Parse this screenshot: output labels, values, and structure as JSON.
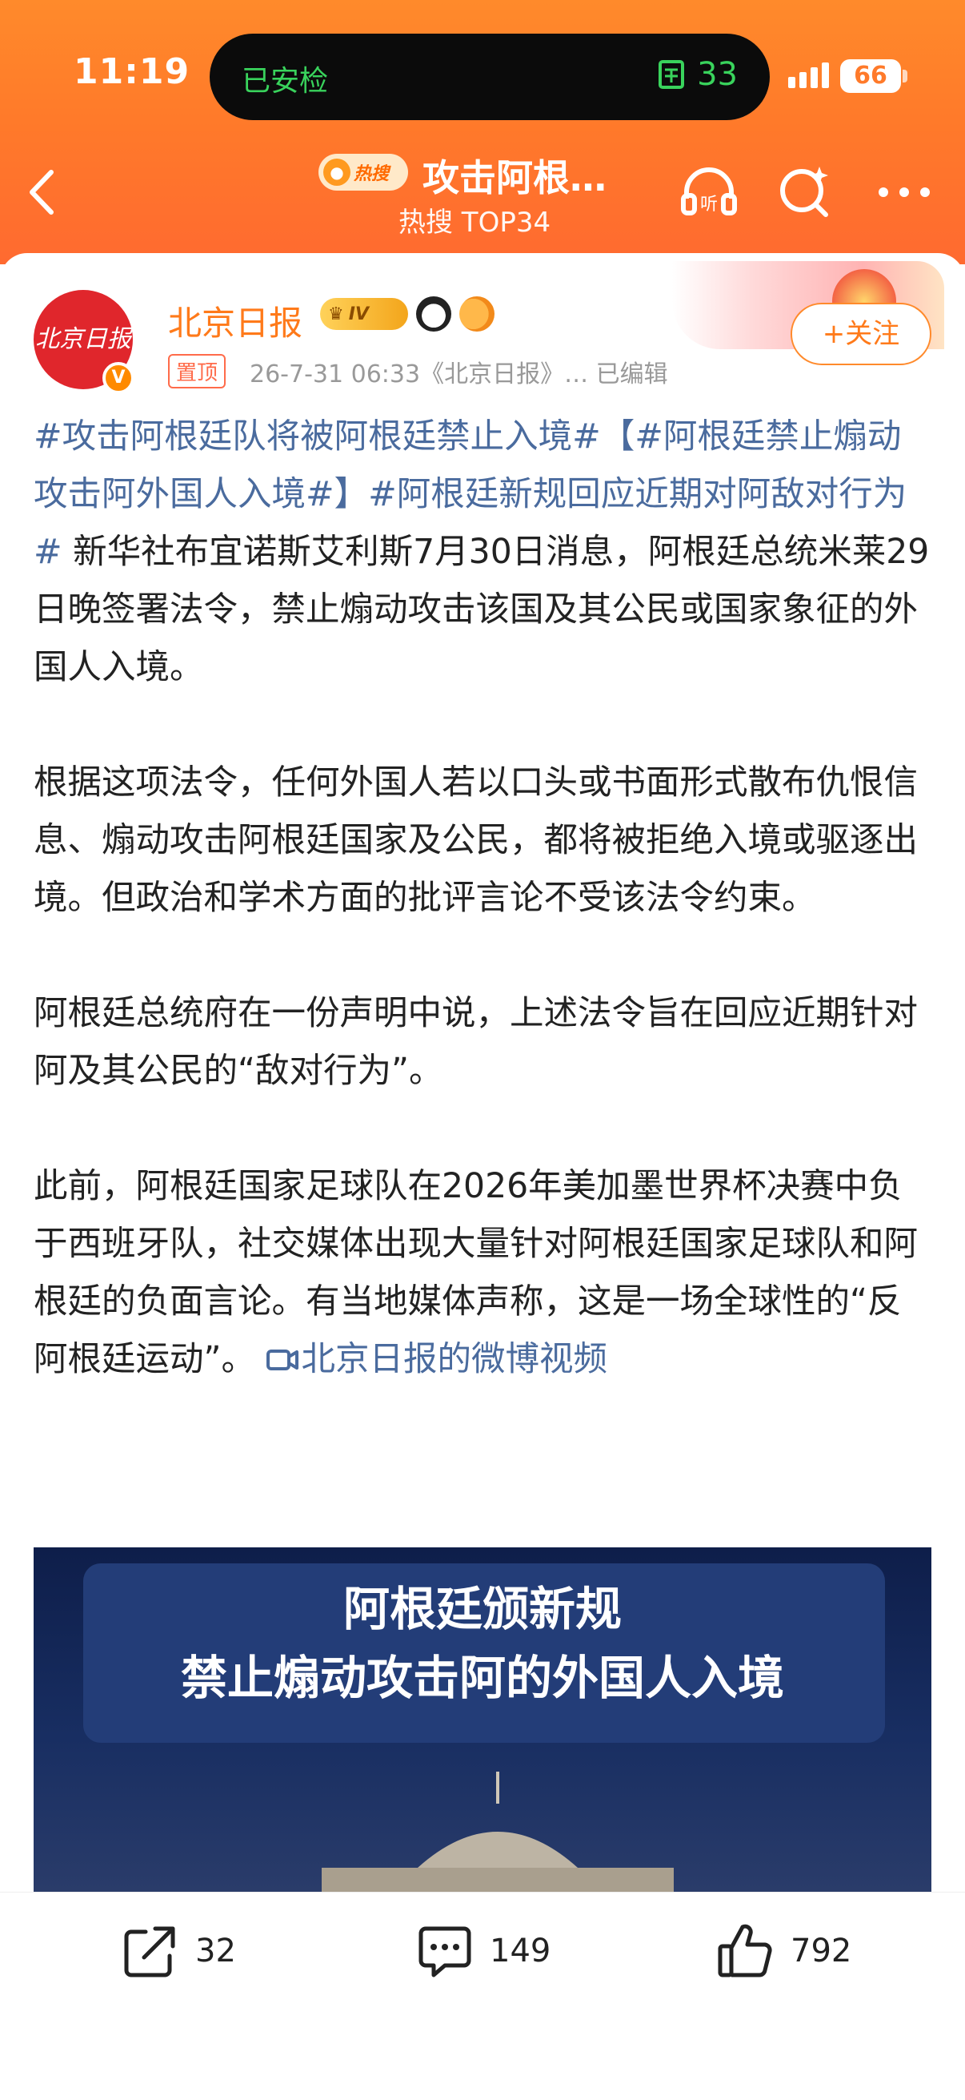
{
  "status_bar": {
    "time": "11:19",
    "island_left": "已安检",
    "island_count": "33",
    "battery": "66"
  },
  "header": {
    "hot_badge": "热搜",
    "title": "攻击阿根…",
    "subtitle": "热搜 TOP34"
  },
  "post": {
    "author": "北京日报",
    "avatar_text": "北京日报",
    "badge_level": "IV",
    "pinned": "置顶",
    "meta": "26-7-31 06:33《北京日报》… 已编辑",
    "follow_label": "+关注",
    "tag1": "#攻击阿根廷队将被阿根廷禁止入境#",
    "tag2": "【#阿根廷禁止煽动攻击阿外国人入境#】",
    "tag3": "#阿根廷新规回应近期对阿敌对行为#",
    "para1": " 新华社布宜诺斯艾利斯7月30日消息，阿根廷总统米莱29日晚签署法令，禁止煽动攻击该国及其公民或国家象征的外国人入境。",
    "para2": "根据这项法令，任何外国人若以口头或书面形式散布仇恨信息、煽动攻击阿根廷国家及公民，都将被拒绝入境或驱逐出境。但政治和学术方面的批评言论不受该法令约束。",
    "para3": "阿根廷总统府在一份声明中说，上述法令旨在回应近期针对阿及其公民的“敌对行为”。",
    "para4": "此前，阿根廷国家足球队在2026年美加墨世界杯决赛中负于西班牙队，社交媒体出现大量针对阿根廷国家足球队和阿根廷的负面言论。有当地媒体声称，这是一场全球性的“反阿根廷运动”。 ",
    "video_link": "北京日报的微博视频",
    "video_line1": "阿根廷颁新规",
    "video_line2": "禁止煽动攻击阿的外国人入境"
  },
  "actions": {
    "repost_count": "32",
    "comment_count": "149",
    "like_count": "792"
  },
  "colors": {
    "header_orange": "#ff7a2a",
    "link_blue": "#4a6b9e",
    "author_orange": "#ff7a1a"
  }
}
